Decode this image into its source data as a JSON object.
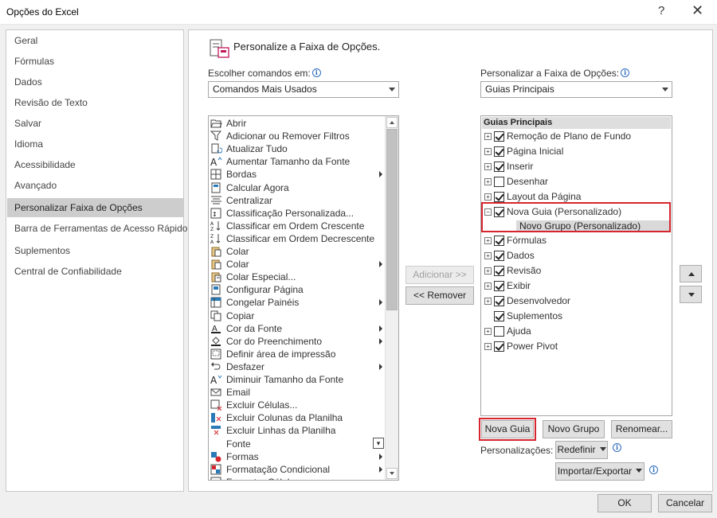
{
  "window": {
    "title": "Opções do Excel",
    "help": "?",
    "close": "✕"
  },
  "nav": {
    "items": [
      {
        "label": "Geral"
      },
      {
        "label": "Fórmulas"
      },
      {
        "label": "Dados"
      },
      {
        "label": "Revisão de Texto"
      },
      {
        "label": "Salvar"
      },
      {
        "label": "Idioma"
      },
      {
        "label": "Acessibilidade"
      },
      {
        "label": "Avançado"
      },
      {
        "label": "Personalizar Faixa de Opções",
        "selected": true
      },
      {
        "label": "Barra de Ferramentas de Acesso Rápido"
      },
      {
        "label": "Suplementos"
      },
      {
        "label": "Central de Confiabilidade"
      }
    ]
  },
  "main": {
    "title": "Personalize a Faixa de Opções.",
    "left": {
      "label": "Escolher comandos em:",
      "combo_value": "Comandos Mais Usados",
      "commands": [
        {
          "label": "Abrir",
          "icon": "folder-open-icon"
        },
        {
          "label": "Adicionar ou Remover Filtros",
          "icon": "filter-icon"
        },
        {
          "label": "Atualizar Tudo",
          "icon": "refresh-all-icon"
        },
        {
          "label": "Aumentar Tamanho da Fonte",
          "icon": "font-grow-icon"
        },
        {
          "label": "Bordas",
          "icon": "borders-icon",
          "submenu": true
        },
        {
          "label": "Calcular Agora",
          "icon": "calculate-icon"
        },
        {
          "label": "Centralizar",
          "icon": "align-center-icon"
        },
        {
          "label": "Classificação Personalizada...",
          "icon": "custom-sort-icon"
        },
        {
          "label": "Classificar em Ordem Crescente",
          "icon": "sort-asc-icon"
        },
        {
          "label": "Classificar em Ordem Decrescente",
          "icon": "sort-desc-icon"
        },
        {
          "label": "Colar",
          "icon": "paste-icon"
        },
        {
          "label": "Colar",
          "icon": "paste-icon",
          "submenu": true
        },
        {
          "label": "Colar Especial...",
          "icon": "paste-special-icon"
        },
        {
          "label": "Configurar Página",
          "icon": "page-setup-icon"
        },
        {
          "label": "Congelar Painéis",
          "icon": "freeze-panes-icon",
          "submenu": true
        },
        {
          "label": "Copiar",
          "icon": "copy-icon"
        },
        {
          "label": "Cor da Fonte",
          "icon": "font-color-icon",
          "submenu": true
        },
        {
          "label": "Cor do Preenchimento",
          "icon": "fill-color-icon",
          "submenu": true
        },
        {
          "label": "Definir área de impressão",
          "icon": "print-area-icon"
        },
        {
          "label": "Desfazer",
          "icon": "undo-icon",
          "submenu": true
        },
        {
          "label": "Diminuir Tamanho da Fonte",
          "icon": "font-shrink-icon"
        },
        {
          "label": "Email",
          "icon": "email-icon"
        },
        {
          "label": "Excluir Células...",
          "icon": "delete-cells-icon"
        },
        {
          "label": "Excluir Colunas da Planilha",
          "icon": "delete-columns-icon"
        },
        {
          "label": "Excluir Linhas da Planilha",
          "icon": "delete-rows-icon"
        },
        {
          "label": "Fonte",
          "icon": "",
          "combo": true
        },
        {
          "label": "Formas",
          "icon": "shapes-icon",
          "submenu": true
        },
        {
          "label": "Formatação Condicional",
          "icon": "conditional-format-icon",
          "submenu": true
        },
        {
          "label": "Formatar Células",
          "icon": "format-cells-icon"
        }
      ]
    },
    "middle": {
      "add_label": "Adicionar >>",
      "remove_label": "<< Remover"
    },
    "right": {
      "label": "Personalizar a Faixa de Opções:",
      "combo_value": "Guias Principais",
      "tree_header": "Guias Principais",
      "tabs": [
        {
          "label": "Remoção de Plano de Fundo",
          "checked": true,
          "expander": "+"
        },
        {
          "label": "Página Inicial",
          "checked": true,
          "expander": "+"
        },
        {
          "label": "Inserir",
          "checked": true,
          "expander": "+"
        },
        {
          "label": "Desenhar",
          "checked": false,
          "expander": "+"
        },
        {
          "label": "Layout da Página",
          "checked": true,
          "expander": "+"
        },
        {
          "label": "Nova Guia (Personalizado)",
          "checked": true,
          "expander": "−"
        },
        {
          "label": "Fórmulas",
          "checked": true,
          "expander": "+"
        },
        {
          "label": "Dados",
          "checked": true,
          "expander": "+"
        },
        {
          "label": "Revisão",
          "checked": true,
          "expander": "+"
        },
        {
          "label": "Exibir",
          "checked": true,
          "expander": "+"
        },
        {
          "label": "Desenvolvedor",
          "checked": true,
          "expander": "+"
        },
        {
          "label": "Suplementos",
          "checked": true,
          "expander": ""
        },
        {
          "label": "Ajuda",
          "checked": false,
          "expander": "+"
        },
        {
          "label": "Power Pivot",
          "checked": true,
          "expander": "+"
        }
      ],
      "subgroup": "Novo Grupo (Personalizado)",
      "new_tab_label": "Nova Guia",
      "new_group_label": "Novo Grupo",
      "rename_label": "Renomear...",
      "customizations_label": "Personalizações:",
      "reset_label": "Redefinir",
      "import_export_label": "Importar/Exportar"
    }
  },
  "footer": {
    "ok_label": "OK",
    "cancel_label": "Cancelar"
  },
  "colors": {
    "highlight": "#d6252f",
    "selected_nav": "#cdcdcd",
    "info": "#2d6cc0"
  }
}
